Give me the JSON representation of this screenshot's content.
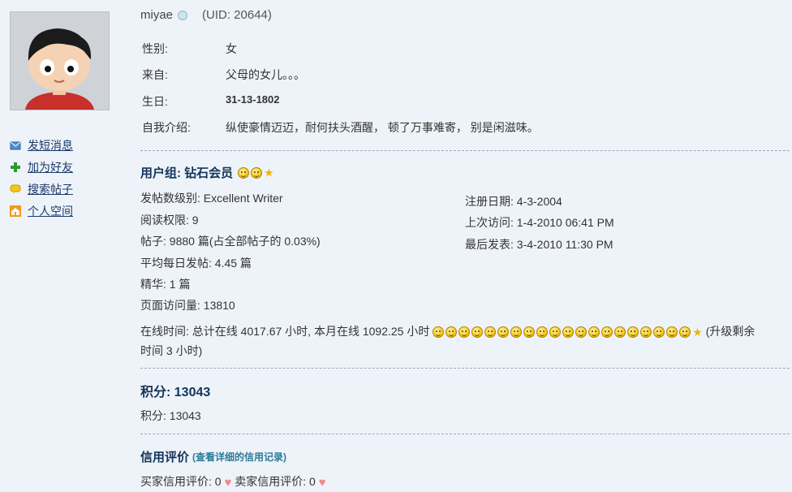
{
  "user": {
    "name": "miyae",
    "uid": "(UID: 20644)"
  },
  "sidebar": {
    "items": [
      {
        "label": "发短消息",
        "icon": "envelope-icon"
      },
      {
        "label": "加为好友",
        "icon": "plus-icon"
      },
      {
        "label": "搜索帖子",
        "icon": "speech-bubble-icon"
      },
      {
        "label": "个人空间",
        "icon": "home-icon"
      }
    ]
  },
  "profile": {
    "gender_label": "性别:",
    "gender": "女",
    "from_label": "来自:",
    "from": "父母的女儿。。。",
    "birthday_label": "生日:",
    "birthday": "31-13-1802",
    "intro_label": "自我介绍:",
    "intro": "纵使豪情迈迈，耐何扶头酒醒， 顿了万事难寄， 别是闲滋味。"
  },
  "group": {
    "title": "用户组: 钻石会员",
    "post_level": "发帖数级别: Excellent Writer",
    "read_perm": "阅读权限: 9",
    "posts": "帖子: 9880 篇(占全部帖子的 0.03%)",
    "daily_avg": "平均每日发帖: 4.45 篇",
    "digest": "精华: 1 篇",
    "page_views": "页面访问量: 13810",
    "reg_date": "注册日期: 4-3-2004",
    "last_visit": "上次访问: 1-4-2010 06:41 PM",
    "last_post": "最后发表: 3-4-2010 11:30 PM",
    "online_text": "在线时间: 总计在线 4017.67 小时, 本月在线 1092.25 小时",
    "online_upgrade": "(升级剩余",
    "online_remaining": "时间 3 小时)"
  },
  "points": {
    "title": "积分: 13043",
    "value_line": "积分: 13043"
  },
  "credit": {
    "title": "信用评价",
    "detail_link": "(查看详细的信用记录)",
    "buyer": "买家信用评价: 0",
    "seller": "卖家信用评价: 0"
  },
  "colors": {
    "background": "#eef3f9",
    "heading": "#123458",
    "link": "#1b3a6b",
    "accent_link": "#2a7b96"
  }
}
